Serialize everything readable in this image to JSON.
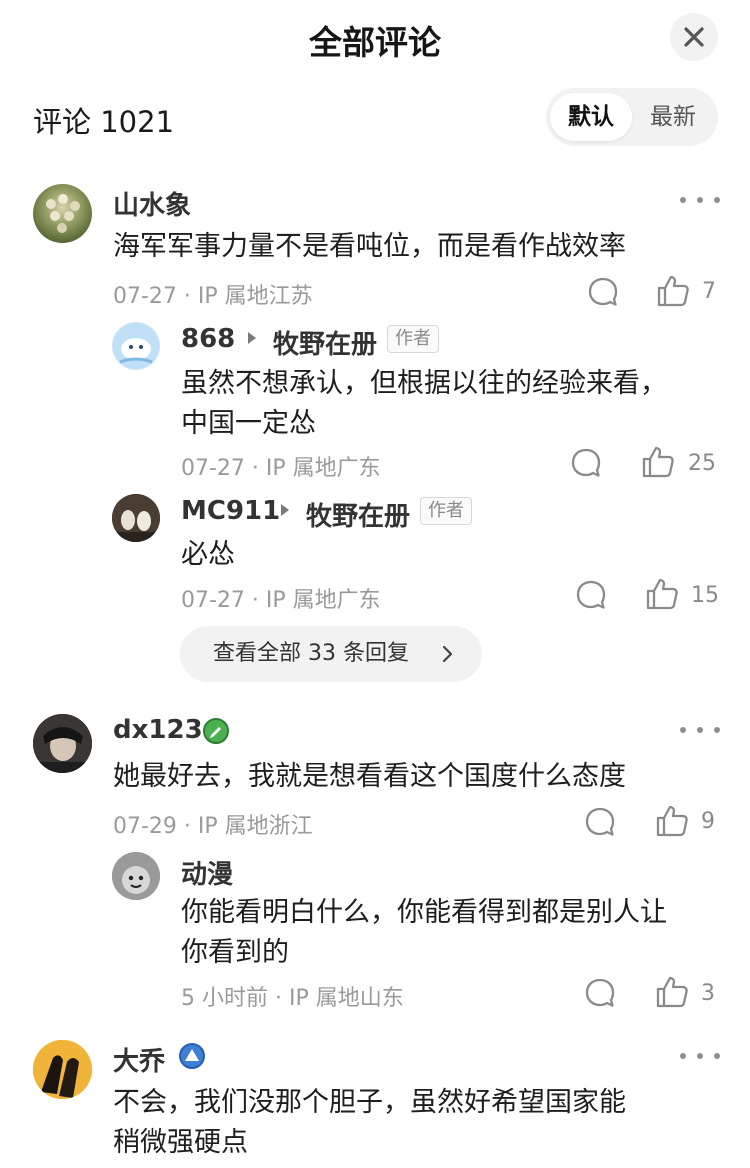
{
  "header": {
    "title": "全部评论"
  },
  "count": {
    "label": "评论 1021"
  },
  "sort": {
    "default_label": "默认",
    "latest_label": "最新"
  },
  "comments": [
    {
      "user": "山水象",
      "text": "海军军事力量不是看吨位，而是看作战效率",
      "meta": "07-27 · IP 属地江苏",
      "likes": "7",
      "replies": [
        {
          "user": "868",
          "reply_to": "牧野在册",
          "tag": "作者",
          "text_lines": [
            "虽然不想承认，但根据以往的经验来看，",
            "中国一定怂"
          ],
          "meta": "07-27 · IP 属地广东",
          "likes": "25"
        },
        {
          "user": "MC911",
          "reply_to": "牧野在册",
          "tag": "作者",
          "text_lines": [
            "必怂"
          ],
          "meta": "07-27 · IP 属地广东",
          "likes": "15"
        }
      ],
      "view_all": "查看全部 33 条回复"
    },
    {
      "user": "dx123",
      "text": "她最好去，我就是想看看这个国度什么态度",
      "meta": "07-29 · IP 属地浙江",
      "likes": "9",
      "replies": [
        {
          "user": "动漫",
          "text_lines": [
            "你能看明白什么，你能看得到都是别人让",
            "你看到的"
          ],
          "meta": "5 小时前  · IP 属地山东",
          "likes": "3"
        }
      ]
    },
    {
      "user": "大乔",
      "text_lines": [
        "不会，我们没那个胆子，虽然好希望国家能",
        "稍微强硬点"
      ]
    }
  ],
  "colors": {
    "accent_badge_green": "#4caf50",
    "accent_badge_blue": "#3f7fd6",
    "meta_gray": "#9a9a9a"
  }
}
